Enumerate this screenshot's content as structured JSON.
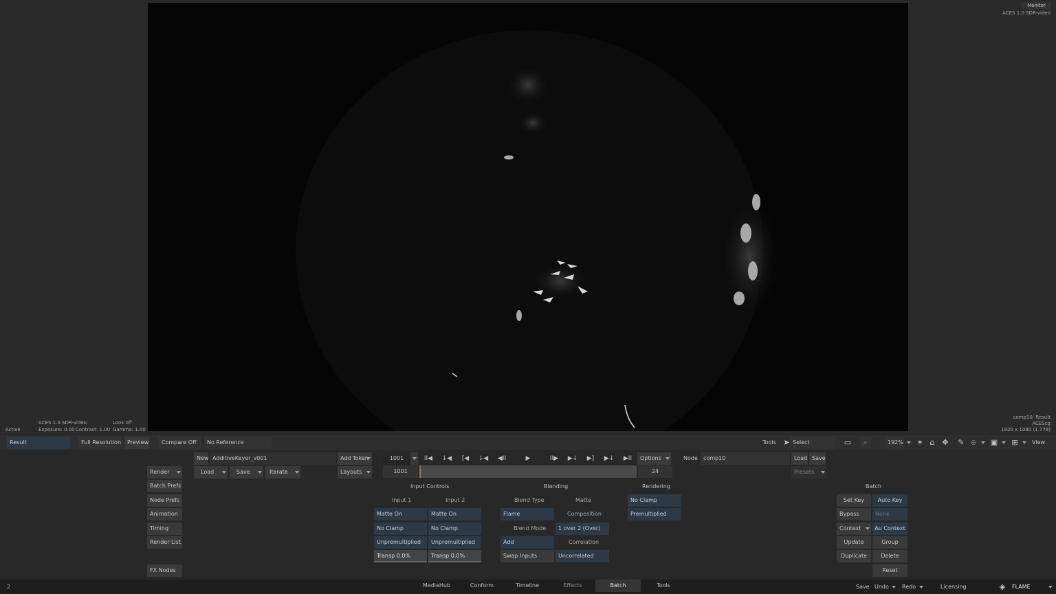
{
  "viewer": {
    "monitor_label": "Monitor",
    "colorspace_top": "ACES 1.0 SDR-video",
    "info_left": {
      "colorspace": "ACES 1.0 SDR-video",
      "look": "Look off",
      "exposure": "Exposure: 0.00",
      "contrast": "Contrast: 1.00",
      "gamma": "Gamma: 1.00",
      "state": "Active"
    },
    "info_right": {
      "node": "comp10: Result",
      "space": "ACEScg",
      "resolution": "1920 x 1080 (1.778)"
    }
  },
  "viewer_bar": {
    "result": "Result",
    "full_resolution": "Full Resolution",
    "preview": "Preview",
    "compare": "Compare Off",
    "reference": "No Reference",
    "tools": "Tools",
    "select": "Select",
    "zoom": "192%",
    "view": "View"
  },
  "batch_left": {
    "render": "Render",
    "items": [
      "Batch Prefs",
      "Node Prefs",
      "Animation",
      "Timing",
      "Render List"
    ],
    "fx_nodes": "FX Nodes"
  },
  "setup": {
    "new": "New",
    "name": "AdditiveKeyer_v001",
    "add_token": "Add Token",
    "load": "Load",
    "save": "Save",
    "iterate": "Iterate",
    "layouts": "Layouts"
  },
  "transport": {
    "frame": "1001",
    "start_frame": "1001",
    "fps": "24",
    "options": "Options",
    "buttons": [
      "II◀",
      "↓◀",
      "[◀",
      "↓◀",
      "◀II",
      "▶",
      "II▶",
      "▶↓",
      "▶]",
      "▶↓",
      "▶II"
    ]
  },
  "node": {
    "label": "Node",
    "name": "comp10",
    "load": "Load",
    "save": "Save",
    "presets": "Presets"
  },
  "input_controls": {
    "title": "Input Controls",
    "input1": {
      "label": "Input 1",
      "matte": "Matte On",
      "clamp": "No Clamp",
      "premult": "Unpremultiplied",
      "transp": "Transp 0.0%"
    },
    "input2": {
      "label": "Input 2",
      "matte": "Matte On",
      "clamp": "No Clamp",
      "premult": "Unpremultiplied",
      "transp": "Transp 0.0%"
    }
  },
  "blending": {
    "title": "Blending",
    "blend_type_label": "Blend Type",
    "blend_type": "Flame",
    "blend_mode_label": "Blend Mode",
    "blend_mode": "Add",
    "swap_inputs": "Swap Inputs",
    "matte_label": "Matte",
    "composition": "Composition",
    "matte_mode": "1 over 2 (Over)",
    "correlation_label": "Correlation",
    "correlation": "Uncorrelated"
  },
  "rendering": {
    "title": "Rendering",
    "clamp": "No Clamp",
    "premult": "Premultiplied"
  },
  "batch_right": {
    "title": "Batch",
    "set_key": "Set Key",
    "auto_key": "Auto Key",
    "bypass": "Bypass",
    "none": "None",
    "context": "Context",
    "au_context": "Au Context",
    "update": "Update",
    "group": "Group",
    "duplicate": "Duplicate",
    "delete": "Delete",
    "reset": "Reset"
  },
  "tabs": [
    "MediaHub",
    "Conform",
    "Timeline",
    "Effects",
    "Batch",
    "Tools"
  ],
  "active_tab": "Batch",
  "status": {
    "left_number": "2",
    "save": "Save",
    "undo": "Undo",
    "redo": "Redo",
    "licensing": "Licensing",
    "brand": "FLAME"
  }
}
